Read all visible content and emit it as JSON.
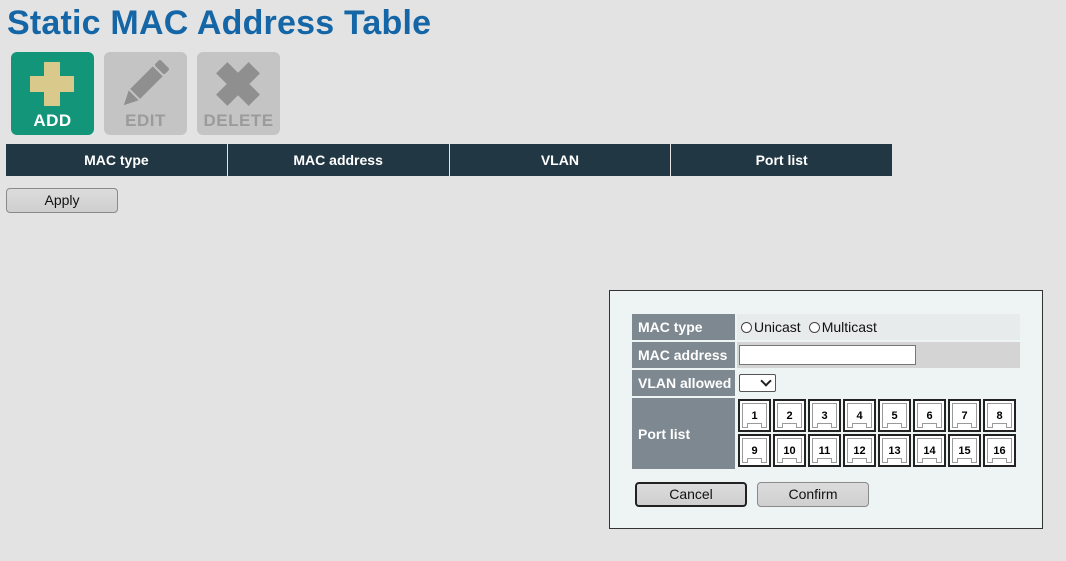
{
  "page": {
    "title": "Static MAC Address Table"
  },
  "toolbar": {
    "add_label": "ADD",
    "edit_label": "EDIT",
    "delete_label": "DELETE"
  },
  "table": {
    "columns": [
      "MAC type",
      "MAC address",
      "VLAN",
      "Port list"
    ]
  },
  "apply_label": "Apply",
  "dialog": {
    "mac_type_label": "MAC type",
    "mac_type_options": [
      "Unicast",
      "Multicast"
    ],
    "mac_address_label": "MAC address",
    "mac_address_value": "",
    "vlan_label": "VLAN allowed",
    "vlan_value": "",
    "port_list_label": "Port list",
    "ports": [
      "1",
      "2",
      "3",
      "4",
      "5",
      "6",
      "7",
      "8",
      "9",
      "10",
      "11",
      "12",
      "13",
      "14",
      "15",
      "16"
    ],
    "cancel_label": "Cancel",
    "confirm_label": "Confirm"
  },
  "colors": {
    "title": "#1566a6",
    "add_button": "#13957a",
    "add_icon": "#d9c98a",
    "disabled_button": "#c4c4c4",
    "table_header": "#213743",
    "form_label_bg": "#7d8890"
  },
  "icons": {
    "add": "plus-icon",
    "edit": "pencil-icon",
    "delete": "x-icon"
  }
}
